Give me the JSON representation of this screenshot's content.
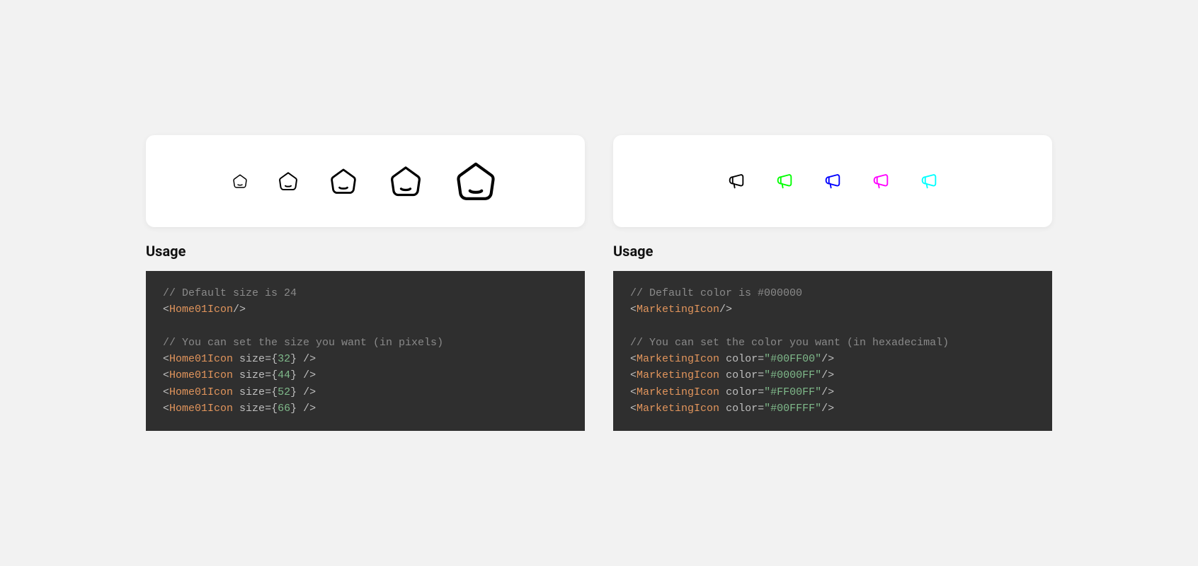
{
  "left": {
    "heading": "Usage",
    "icons": [
      {
        "size": 24,
        "name": "home-icon"
      },
      {
        "size": 32,
        "name": "home-icon"
      },
      {
        "size": 44,
        "name": "home-icon"
      },
      {
        "size": 52,
        "name": "home-icon"
      },
      {
        "size": 66,
        "name": "home-icon"
      }
    ],
    "code": {
      "comment1": "// Default size is 24",
      "line1_tag": "Home01Icon",
      "comment2": "// You can set the size you want (in pixels)",
      "examples": [
        {
          "tag": "Home01Icon",
          "attr": "size",
          "value": "32"
        },
        {
          "tag": "Home01Icon",
          "attr": "size",
          "value": "44"
        },
        {
          "tag": "Home01Icon",
          "attr": "size",
          "value": "52"
        },
        {
          "tag": "Home01Icon",
          "attr": "size",
          "value": "66"
        }
      ]
    }
  },
  "right": {
    "heading": "Usage",
    "icons": [
      {
        "color": "#000000",
        "name": "marketing-icon"
      },
      {
        "color": "#00FF00",
        "name": "marketing-icon"
      },
      {
        "color": "#0000FF",
        "name": "marketing-icon"
      },
      {
        "color": "#FF00FF",
        "name": "marketing-icon"
      },
      {
        "color": "#00FFFF",
        "name": "marketing-icon"
      }
    ],
    "code": {
      "comment1": "// Default color is #000000",
      "line1_tag": "MarketingIcon",
      "comment2": "// You can set the color you want (in hexadecimal)",
      "examples": [
        {
          "tag": "MarketingIcon",
          "attr": "color",
          "value": "#00FF00"
        },
        {
          "tag": "MarketingIcon",
          "attr": "color",
          "value": "#0000FF"
        },
        {
          "tag": "MarketingIcon",
          "attr": "color",
          "value": "#FF00FF"
        },
        {
          "tag": "MarketingIcon",
          "attr": "color",
          "value": "#00FFFF"
        }
      ]
    }
  }
}
